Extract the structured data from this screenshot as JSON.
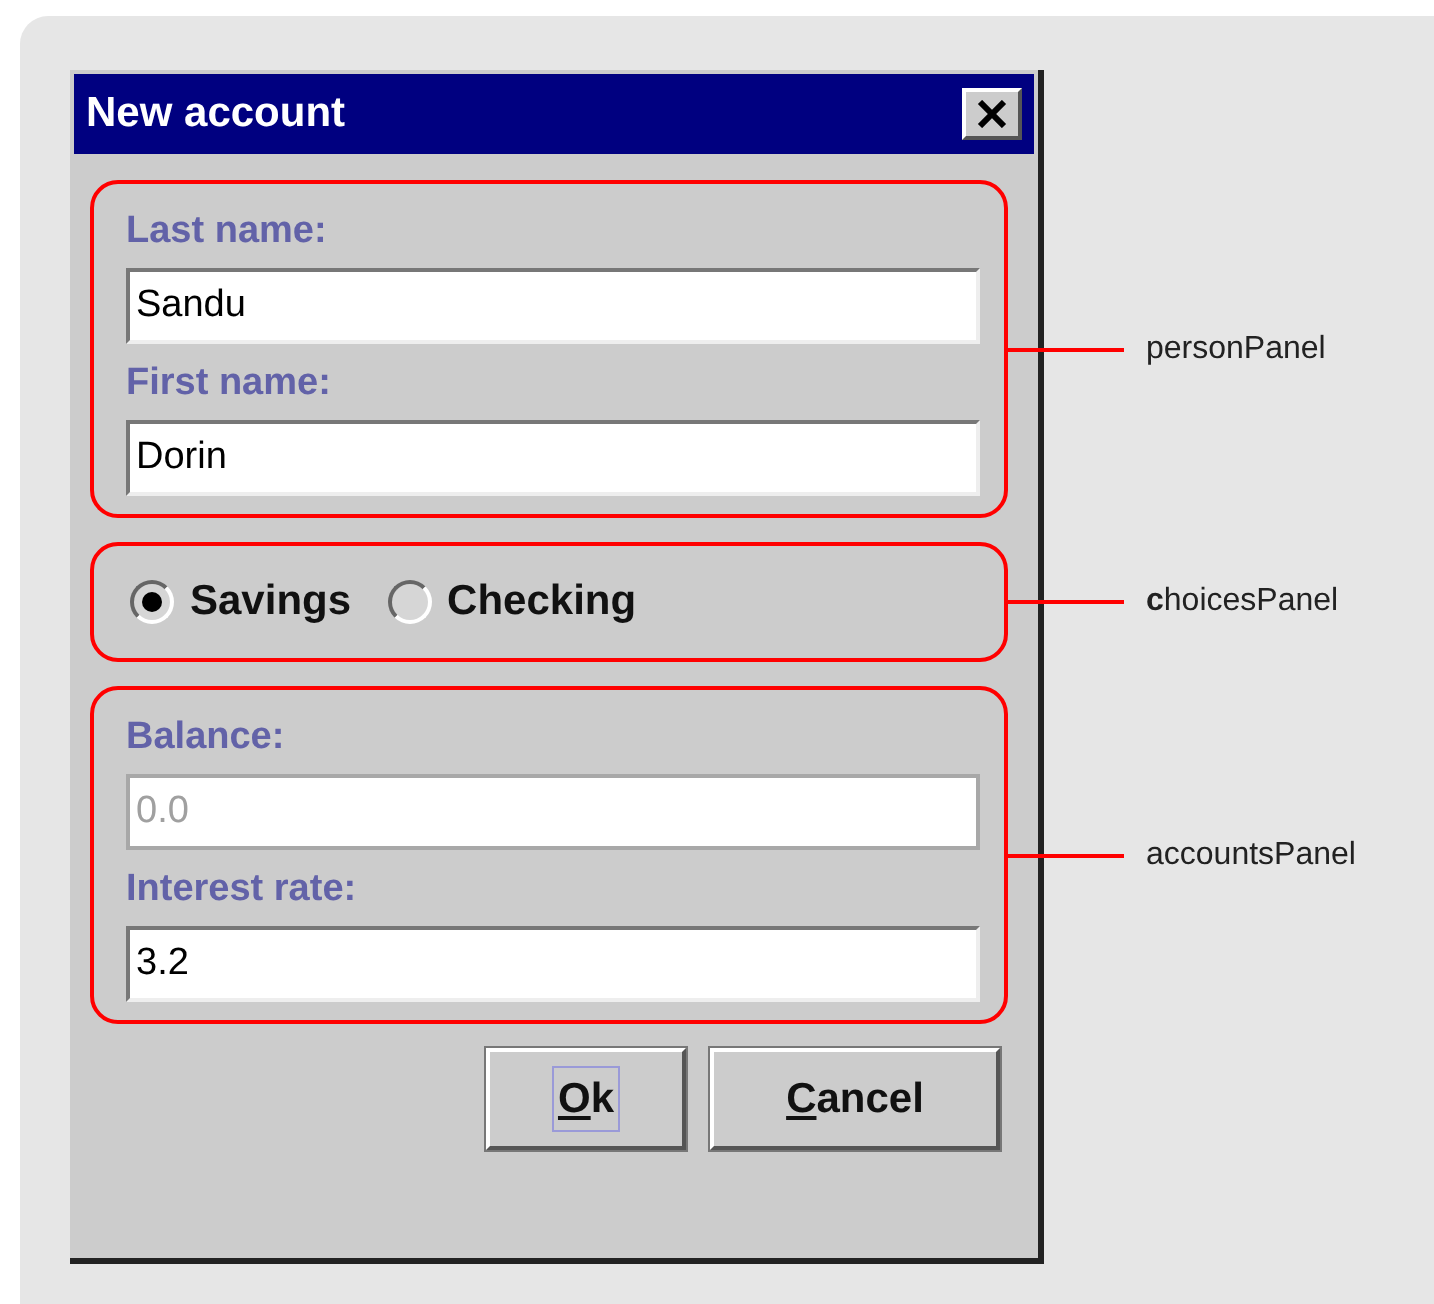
{
  "window": {
    "title": "New account"
  },
  "panels": [
    {
      "kind": "fields",
      "annotation": "personPanel",
      "fields": [
        {
          "label": "Last name:",
          "value": "Sandu",
          "disabled": false
        },
        {
          "label": "First name:",
          "value": "Dorin",
          "disabled": false
        }
      ]
    },
    {
      "kind": "choices",
      "annotation": "**c**hoicesPanel",
      "options": [
        {
          "label": "Savings",
          "selected": true
        },
        {
          "label": "Checking",
          "selected": false
        }
      ]
    },
    {
      "kind": "fields",
      "annotation": "accountsPanel",
      "fields": [
        {
          "label": "Balance:",
          "value": "0.0",
          "disabled": true
        },
        {
          "label": "Interest rate:",
          "value": "3.2",
          "disabled": false
        }
      ]
    }
  ],
  "buttons": [
    {
      "label": "Ok",
      "focused": true
    },
    {
      "label": "Cancel",
      "focused": false
    }
  ]
}
